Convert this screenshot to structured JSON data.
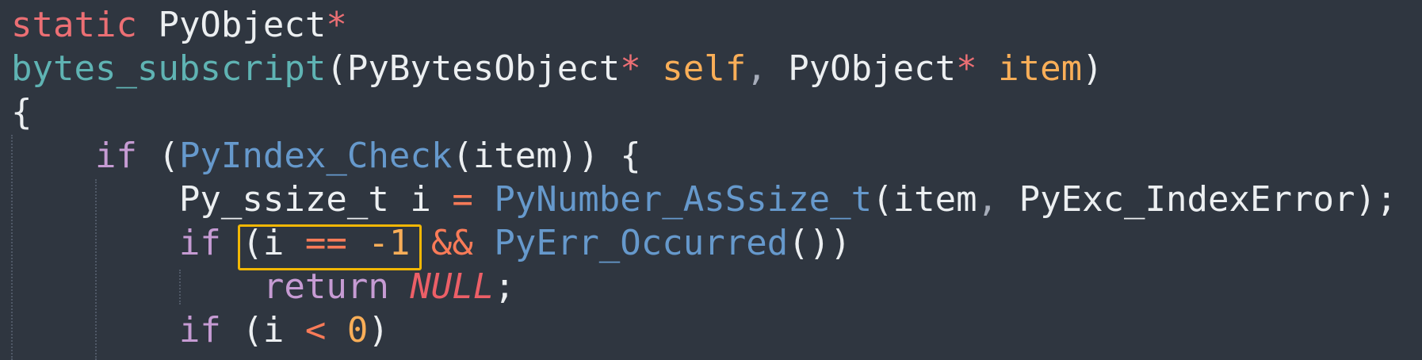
{
  "code": {
    "line1": {
      "storage": "static",
      "type": "PyObject",
      "ptr": "*"
    },
    "line2": {
      "fn": "bytes_subscript",
      "open": "(",
      "type1": "PyBytesObject",
      "ptr1": "*",
      "param1": "self",
      "comma": ",",
      "type2": "PyObject",
      "ptr2": "*",
      "param2": "item",
      "close": ")"
    },
    "line3": {
      "brace": "{"
    },
    "line4": {
      "kw": "if",
      "open": "(",
      "call": "PyIndex_Check",
      "args": "(item)",
      "close": ")",
      "brace": "{"
    },
    "line5": {
      "type": "Py_ssize_t",
      "var": "i",
      "assign": "=",
      "call": "PyNumber_AsSsize_t",
      "arg1": "(item",
      "comma": ",",
      "arg2": "PyExc_IndexError);"
    },
    "line6": {
      "kw": "if",
      "open": "(",
      "var": "i",
      "eq": "==",
      "num": "-1",
      "and": "&&",
      "call": "PyErr_Occurred",
      "close": "())"
    },
    "line7": {
      "kw": "return",
      "nullv": "NULL",
      "semi": ";"
    },
    "line8": {
      "kw": "if",
      "open": "(",
      "var": "i",
      "lt": "<",
      "num": "0",
      "close": ")"
    }
  },
  "highlight_color": "#f2b705",
  "background_color": "#2f3640"
}
